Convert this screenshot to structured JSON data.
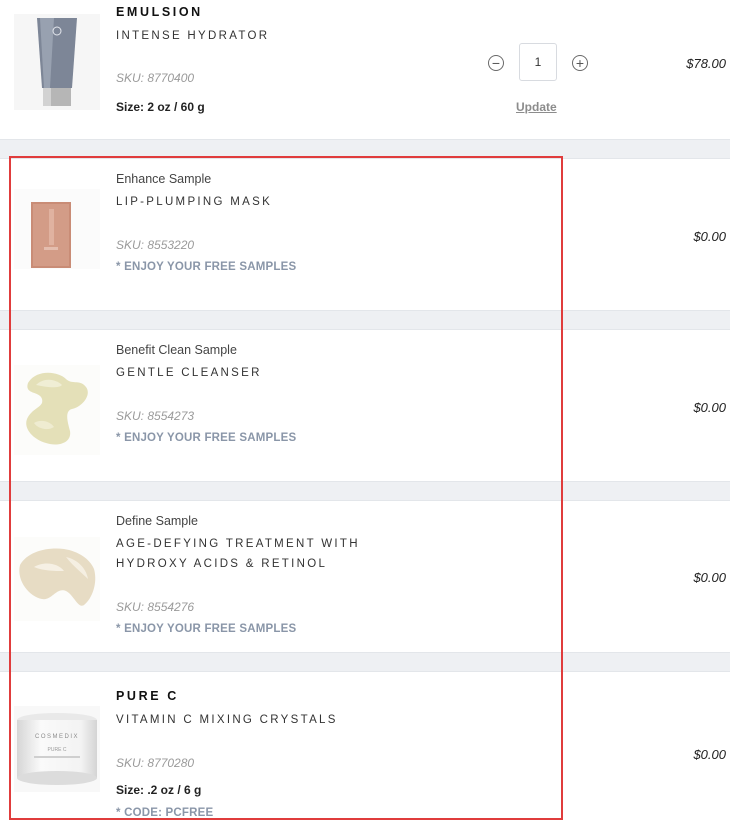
{
  "items": [
    {
      "brand": "EMULSION",
      "description": "INTENSE HYDRATOR",
      "sku": "SKU: 8770400",
      "size": "Size: 2 oz / 60 g",
      "quantity": "1",
      "update_label": "Update",
      "price": "$78.00"
    },
    {
      "sample_name": "Enhance Sample",
      "description": "LIP-PLUMPING MASK",
      "sku": "SKU: 8553220",
      "promo": "* ENJOY YOUR FREE SAMPLES",
      "price": "$0.00"
    },
    {
      "sample_name": "Benefit Clean Sample",
      "description": "GENTLE CLEANSER",
      "sku": "SKU: 8554273",
      "promo": "* ENJOY YOUR FREE SAMPLES",
      "price": "$0.00"
    },
    {
      "sample_name": "Define Sample",
      "description_line1": "AGE-DEFYING TREATMENT WITH",
      "description_line2": "HYDROXY ACIDS & RETINOL",
      "sku": "SKU: 8554276",
      "promo": "* ENJOY YOUR FREE SAMPLES",
      "price": "$0.00"
    },
    {
      "brand": "PURE C",
      "description": "VITAMIN C MIXING CRYSTALS",
      "sku": "SKU: 8770280",
      "size": "Size: .2 oz / 6 g",
      "promo": "* CODE: PCFREE",
      "price": "$0.00",
      "jar_brand": "COSMEDIX",
      "jar_label": "PURE C"
    }
  ],
  "icons": {
    "minus": "minus-circle-icon",
    "plus": "plus-circle-icon"
  },
  "colors": {
    "highlight": "#e03c3c",
    "promo": "#8a96a8",
    "separator": "#eef0f3"
  }
}
